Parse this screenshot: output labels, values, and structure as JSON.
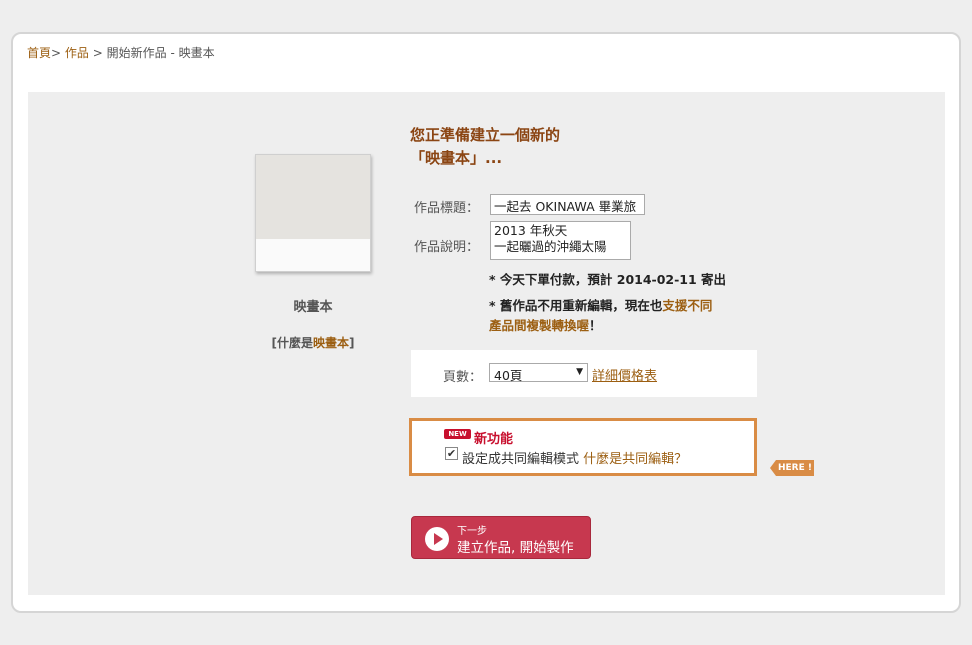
{
  "breadcrumb": {
    "home": "首頁",
    "works": "作品",
    "sep": ">",
    "current": "開始新作品 - 映畫本"
  },
  "product": {
    "name": "映畫本",
    "what_prefix": "[什麼是",
    "what_highlight": "映畫本",
    "what_suffix": "]"
  },
  "form": {
    "heading_line1": "您正準備建立一個新的",
    "heading_line2": "「映畫本」...",
    "title_label": "作品標題：",
    "title_value": "一起去 OKINAWA 畢業旅",
    "desc_label": "作品說明：",
    "desc_value": "2013 年秋天\n一起曬過的沖繩太陽"
  },
  "notes": {
    "ship": "* 今天下單付款，預計 2014-02-11 寄出",
    "convert_prefix": "* 舊作品不用重新編輯，現在也",
    "convert_hl1": "支援不同",
    "convert_hl2": "產品間複製轉換喔",
    "convert_suffix": "！"
  },
  "pages": {
    "label": "頁數：",
    "selected": "40頁",
    "price_link": "詳細價格表"
  },
  "feature": {
    "badge": "NEW",
    "title": "新功能",
    "checkbox_label": "設定成共同編輯模式",
    "link": "什麼是共同編輯？",
    "checked": true,
    "here": "HERE !"
  },
  "next": {
    "small": "下一步",
    "big": "建立作品, 開始製作"
  },
  "colors": {
    "accent": "#9c5f12",
    "heading": "#8b4513",
    "button": "#c7384f",
    "feature_border": "#d98c45",
    "new_red": "#c8102e"
  }
}
